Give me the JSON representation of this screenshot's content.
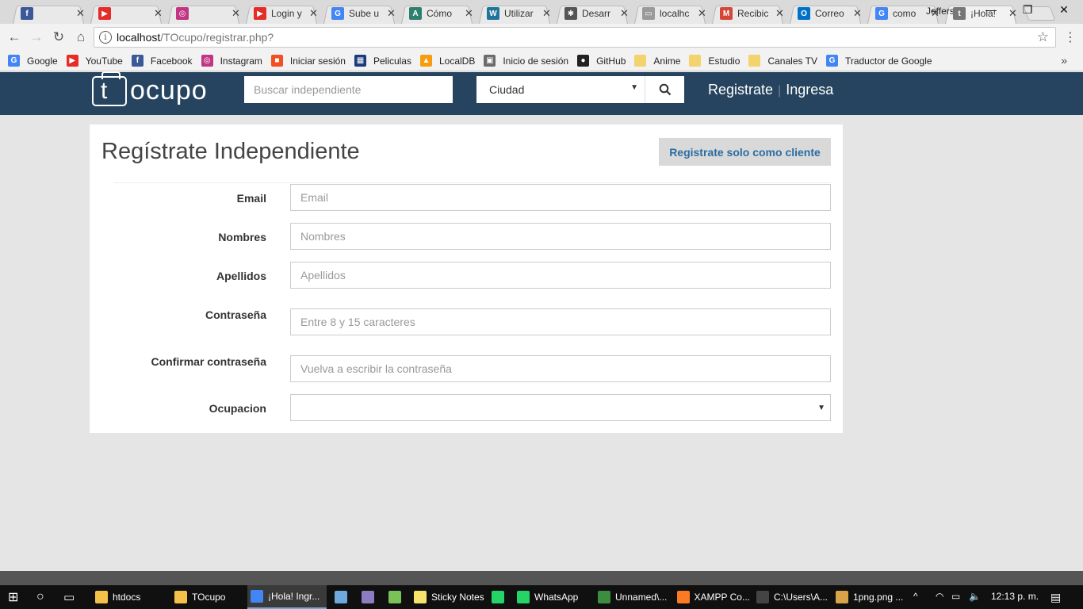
{
  "browser": {
    "tabs": [
      {
        "title": "",
        "icon": "facebook-icon",
        "color": "#3b5998",
        "glyph": "f"
      },
      {
        "title": "",
        "icon": "youtube-icon",
        "color": "#e52d27",
        "glyph": "▶"
      },
      {
        "title": "",
        "icon": "instagram-icon",
        "color": "#c13584",
        "glyph": "◎"
      },
      {
        "title": "Login y",
        "icon": "youtube-icon",
        "color": "#e52d27",
        "glyph": "▶"
      },
      {
        "title": "Sube u",
        "icon": "google-icon",
        "color": "#4285f4",
        "glyph": "G"
      },
      {
        "title": "Cómo",
        "icon": "site-icon",
        "color": "#2f7f6f",
        "glyph": "A"
      },
      {
        "title": "Utilizar",
        "icon": "wordpress-icon",
        "color": "#21759b",
        "glyph": "W"
      },
      {
        "title": "Desarr",
        "icon": "gear-icon",
        "color": "#555555",
        "glyph": "✱"
      },
      {
        "title": "localhc",
        "icon": "page-icon",
        "color": "#9a9a9a",
        "glyph": "▭"
      },
      {
        "title": "Recibic",
        "icon": "gmail-icon",
        "color": "#d44638",
        "glyph": "M"
      },
      {
        "title": "Correo",
        "icon": "outlook-icon",
        "color": "#0072c6",
        "glyph": "O"
      },
      {
        "title": "como",
        "icon": "google-icon",
        "color": "#4285f4",
        "glyph": "G"
      },
      {
        "title": "¡Hola!",
        "icon": "tocupo-icon",
        "color": "#777777",
        "glyph": "t",
        "active": true
      }
    ],
    "profile_name": "Jefferson",
    "url_host": "localhost",
    "url_path": "/TOcupo/registrar.php?",
    "bookmarks": [
      {
        "label": "Google",
        "icon": "google-icon",
        "color": "#4285f4",
        "glyph": "G"
      },
      {
        "label": "YouTube",
        "icon": "youtube-icon",
        "color": "#e52d27",
        "glyph": "▶"
      },
      {
        "label": "Facebook",
        "icon": "facebook-icon",
        "color": "#3b5998",
        "glyph": "f"
      },
      {
        "label": "Instagram",
        "icon": "instagram-icon",
        "color": "#c13584",
        "glyph": "◎"
      },
      {
        "label": "Iniciar sesión",
        "icon": "windows-icon",
        "color": "#f25022",
        "glyph": "■"
      },
      {
        "label": "Peliculas",
        "icon": "clapper-icon",
        "color": "#1a3c7a",
        "glyph": "▦"
      },
      {
        "label": "LocalDB",
        "icon": "phpmyadmin-icon",
        "color": "#f89c0e",
        "glyph": "▲"
      },
      {
        "label": "Inicio de sesión",
        "icon": "image-icon",
        "color": "#6b6b6b",
        "glyph": "▣"
      },
      {
        "label": "GitHub",
        "icon": "github-icon",
        "color": "#222222",
        "glyph": "●"
      },
      {
        "label": "Anime",
        "icon": "folder-icon",
        "color": "#f3d36b",
        "glyph": ""
      },
      {
        "label": "Estudio",
        "icon": "folder-icon",
        "color": "#f3d36b",
        "glyph": ""
      },
      {
        "label": "Canales TV",
        "icon": "folder-icon",
        "color": "#f3d36b",
        "glyph": ""
      },
      {
        "label": "Traductor de Google",
        "icon": "translate-icon",
        "color": "#4285f4",
        "glyph": "G"
      }
    ]
  },
  "site": {
    "logo_text": "ocupo",
    "logo_letter": "t",
    "search_placeholder": "Buscar independiente",
    "city_label": "Ciudad",
    "register_link": "Registrate",
    "login_link": "Ingresa",
    "header_color": "#26445f"
  },
  "form": {
    "title": "Regístrate Independiente",
    "client_button": "Registrate solo como cliente",
    "fields": [
      {
        "label": "Email",
        "placeholder": "Email"
      },
      {
        "label": "Nombres",
        "placeholder": "Nombres"
      },
      {
        "label": "Apellidos",
        "placeholder": "Apellidos"
      },
      {
        "label": "Contraseña",
        "placeholder": "Entre 8 y 15 caracteres"
      },
      {
        "label": "Confirmar contraseña",
        "placeholder": "Vuelva a escribir la contraseña"
      },
      {
        "label": "Ocupacion",
        "placeholder": ""
      }
    ]
  },
  "taskbar": {
    "items": [
      {
        "label": "htdocs",
        "icon": "folder-icon"
      },
      {
        "label": "TOcupo",
        "icon": "folder-icon"
      },
      {
        "label": "¡Hola! Ingr...",
        "icon": "chrome-icon"
      },
      {
        "label": "",
        "icon": "cube-icon"
      },
      {
        "label": "",
        "icon": "app-icon"
      },
      {
        "label": "",
        "icon": "android-icon"
      },
      {
        "label": "Sticky Notes",
        "icon": "sticky-notes-icon"
      },
      {
        "label": "",
        "icon": "whatsapp-icon"
      },
      {
        "label": "WhatsApp",
        "icon": "whatsapp-icon"
      },
      {
        "label": "Unnamed\\...",
        "icon": "editor-icon"
      },
      {
        "label": "XAMPP Co...",
        "icon": "xampp-icon"
      },
      {
        "label": "C:\\Users\\A...",
        "icon": "terminal-icon"
      },
      {
        "label": "1png.png ...",
        "icon": "image-viewer-icon"
      }
    ],
    "time": "12:13 p. m."
  }
}
